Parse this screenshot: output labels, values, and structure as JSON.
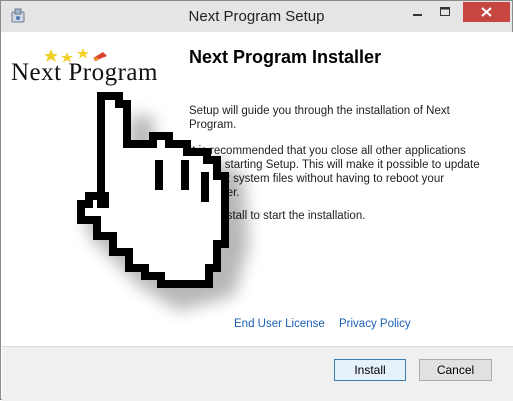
{
  "window": {
    "title": "Next Program Setup",
    "title_icon": "installer-icon"
  },
  "titlebar_buttons": {
    "minimize": "minimize-icon",
    "maximize": "maximize-icon",
    "close": "close-icon"
  },
  "logo": {
    "text": "Next Program"
  },
  "installer": {
    "heading": "Next Program Installer",
    "paragraph1": "Setup will guide you through the installation of Next Program.",
    "paragraph2": "It is recommended that you close all other applications before starting Setup. This will make it possible to update relevant system files without having to reboot your computer.",
    "paragraph3": "Click Install to start the installation."
  },
  "links": {
    "eula": "End User License",
    "privacy": "Privacy Policy"
  },
  "buttons": {
    "install": "Install",
    "cancel": "Cancel"
  },
  "colors": {
    "close_button": "#c7463f",
    "link": "#1a5fb4",
    "titlebar": "#e5e5e5"
  },
  "overlay": {
    "cursor": "hand-pointer-cursor-icon"
  }
}
